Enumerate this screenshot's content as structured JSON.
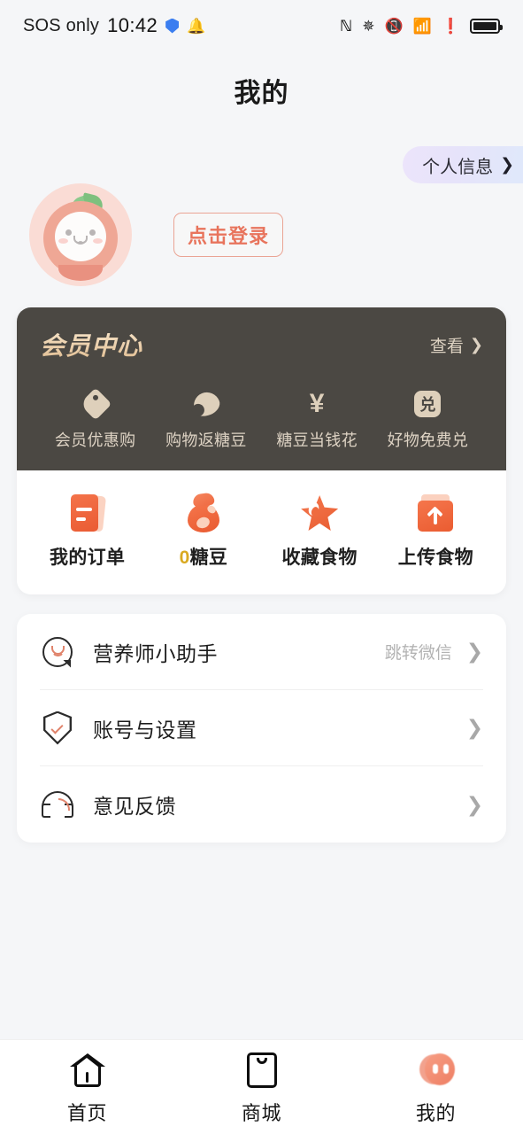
{
  "status_bar": {
    "carrier": "SOS only",
    "time": "10:42",
    "shield_icon": "shield-icon",
    "bell_icon": "bell-icon",
    "nfc_icon": "N",
    "bluetooth_icon": "✳",
    "vibrate_icon": "vibrate-icon",
    "wifi_icon": "wifi-6-icon",
    "alert_icon": "!",
    "battery_icon": "battery-icon"
  },
  "header": {
    "title": "我的",
    "personal_info": {
      "label": "个人信息",
      "chevron": "❯"
    }
  },
  "profile": {
    "avatar_name": "peach-character-avatar",
    "login_button": "点击登录"
  },
  "member_card": {
    "title": "会员中心",
    "more_label": "查看",
    "more_chevron": "❯",
    "benefits": [
      {
        "icon": "tag-icon",
        "label": "会员优惠购"
      },
      {
        "icon": "bean-icon",
        "label": "购物返糖豆"
      },
      {
        "icon": "yen-icon",
        "label": "糖豆当钱花",
        "glyph": "¥"
      },
      {
        "icon": "exchange-icon",
        "label": "好物免费兑",
        "glyph": "兑"
      }
    ],
    "quick_actions": [
      {
        "icon": "order-icon",
        "label": "我的订单"
      },
      {
        "icon": "candy-bag-icon",
        "count": "0",
        "label": "糖豆"
      },
      {
        "icon": "star-icon",
        "label": "收藏食物"
      },
      {
        "icon": "upload-icon",
        "label": "上传食物"
      }
    ]
  },
  "menu": {
    "items": [
      {
        "icon": "chat-bubble-icon",
        "label": "营养师小助手",
        "hint": "跳转微信",
        "chevron": "❯"
      },
      {
        "icon": "shield-check-icon",
        "label": "账号与设置",
        "hint": "",
        "chevron": "❯"
      },
      {
        "icon": "headset-icon",
        "label": "意见反馈",
        "hint": "",
        "chevron": "❯"
      }
    ]
  },
  "bottom_nav": {
    "items": [
      {
        "icon": "home-icon",
        "label": "首页",
        "active": false
      },
      {
        "icon": "mall-bag-icon",
        "label": "商城",
        "active": false
      },
      {
        "icon": "profile-face-icon",
        "label": "我的",
        "active": true
      }
    ]
  },
  "colors": {
    "background": "#f5f6f8",
    "accent_orange": "#ea5c31",
    "accent_salmon": "#e8745c",
    "member_dark": "#4b4843",
    "member_gold": "#efd6b4",
    "coin_gold": "#d9a920"
  }
}
